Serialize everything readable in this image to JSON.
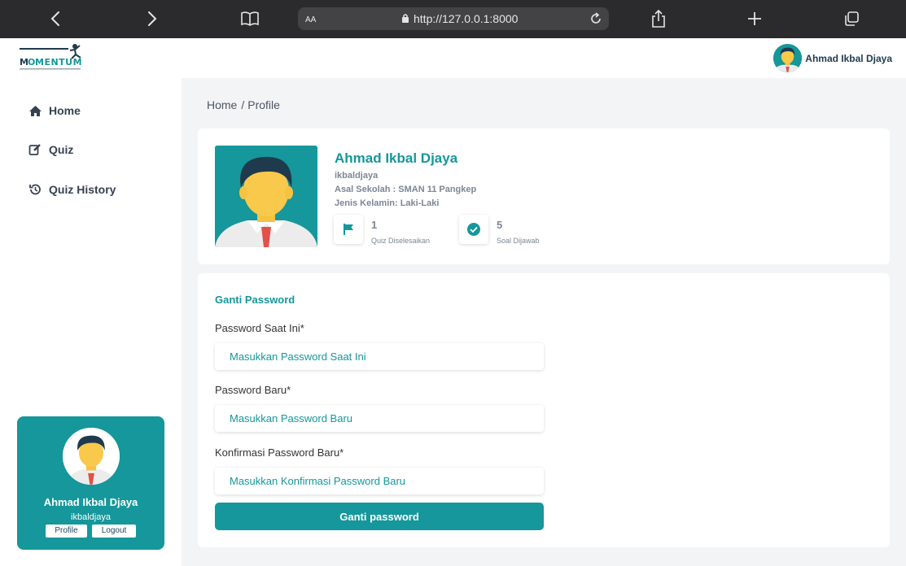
{
  "browser": {
    "text_size_label": "AA",
    "url": "http://127.0.0.1:8000"
  },
  "header": {
    "logo_text": "MOMENTUM",
    "user_name": "Ahmad Ikbal Djaya"
  },
  "sidebar": {
    "items": [
      {
        "label": "Home",
        "icon": "home-icon"
      },
      {
        "label": "Quiz",
        "icon": "edit-icon"
      },
      {
        "label": "Quiz History",
        "icon": "history-icon"
      }
    ],
    "card": {
      "name": "Ahmad Ikbal Djaya",
      "username": "ikbaldjaya",
      "profile_label": "Profile",
      "logout_label": "Logout"
    }
  },
  "breadcrumb": {
    "home": "Home",
    "separator": "/",
    "current": "Profile"
  },
  "profile": {
    "name": "Ahmad Ikbal Djaya",
    "username": "ikbaldjaya",
    "school": "Asal Sekolah : SMAN 11 Pangkep",
    "gender": "Jenis Kelamin: Laki-Laki",
    "stats": [
      {
        "value": "1",
        "label": "Quiz Diselesaikan",
        "icon": "flag-icon"
      },
      {
        "value": "5",
        "label": "Soal Dijawab",
        "icon": "check-circle-icon"
      }
    ]
  },
  "password_form": {
    "title": "Ganti Password",
    "current_label": "Password Saat Ini*",
    "current_placeholder": "Masukkan Password Saat Ini",
    "new_label": "Password Baru*",
    "new_placeholder": "Masukkan Password Baru",
    "confirm_label": "Konfirmasi Password Baru*",
    "confirm_placeholder": "Masukkan Konfirmasi Password Baru",
    "submit_label": "Ganti password"
  },
  "colors": {
    "accent": "#15979b",
    "browser_bar": "#2b2b2d",
    "page_bg": "#f3f4f6"
  }
}
